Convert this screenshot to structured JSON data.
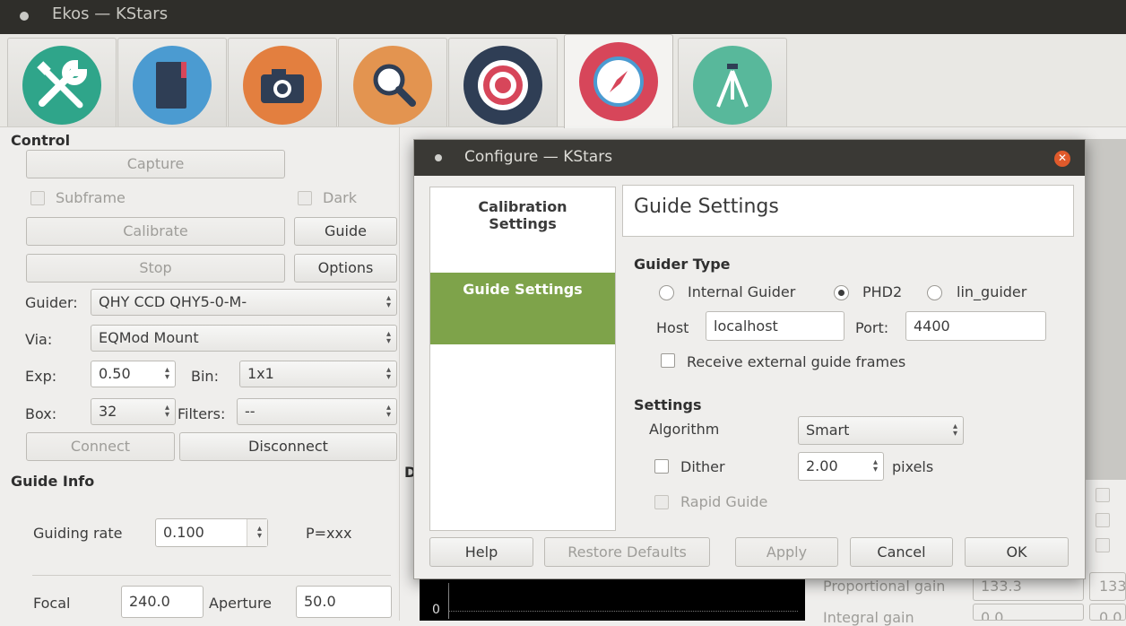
{
  "window": {
    "title": "Ekos — KStars"
  },
  "tabs": [
    {
      "icon": "wrench-screwdriver-icon",
      "color": "#2fa58a"
    },
    {
      "icon": "notebook-icon",
      "color": "#4b9bd1"
    },
    {
      "icon": "camera-icon",
      "color": "#e37f3f"
    },
    {
      "icon": "search-icon",
      "color": "#e39450"
    },
    {
      "icon": "target-icon",
      "color": "#2f3e55"
    },
    {
      "icon": "compass-icon",
      "color": "#d7465a"
    },
    {
      "icon": "tripod-icon",
      "color": "#58b89b"
    }
  ],
  "control": {
    "title": "Control",
    "capture": "Capture",
    "subframe": "Subframe",
    "dark": "Dark",
    "calibrate": "Calibrate",
    "guide": "Guide",
    "stop": "Stop",
    "options": "Options",
    "guider_label": "Guider:",
    "guider_value": "QHY CCD QHY5-0-M-",
    "via_label": "Via:",
    "via_value": "EQMod Mount",
    "exp_label": "Exp:",
    "exp_value": "0.50",
    "bin_label": "Bin:",
    "bin_value": "1x1",
    "box_label": "Box:",
    "box_value": "32",
    "filters_label": "Filters:",
    "filters_value": "--",
    "connect": "Connect",
    "disconnect": "Disconnect"
  },
  "guide_info": {
    "title": "Guide Info",
    "rate_label": "Guiding rate",
    "rate_value": "0.100",
    "p_label": "P=xxx",
    "focal_label": "Focal",
    "focal_value": "240.0",
    "aperture_label": "Aperture",
    "aperture_value": "50.0"
  },
  "background_right": {
    "cut_d": "D",
    "prop_gain_label": "Proportional gain",
    "prop_gain_value": "133.3",
    "prop_gain_value2": "133",
    "integral_gain_label": "Integral gain",
    "integral_gain_value": "0.0",
    "integral_gain_value2": "0.0",
    "graph_zero": "0"
  },
  "dialog": {
    "title": "Configure — KStars",
    "nav": [
      "Calibration Settings",
      "Guide Settings"
    ],
    "header": "Guide Settings",
    "guider_type_title": "Guider Type",
    "radio_internal": "Internal Guider",
    "radio_phd2": "PHD2",
    "radio_lin": "lin_guider",
    "host_label": "Host",
    "host_value": "localhost",
    "port_label": "Port:",
    "port_value": "4400",
    "receive_frames": "Receive external guide frames",
    "settings_title": "Settings",
    "algorithm_label": "Algorithm",
    "algorithm_value": "Smart",
    "dither_label": "Dither",
    "dither_value": "2.00",
    "pixels_label": "pixels",
    "rapid_guide": "Rapid Guide",
    "buttons": {
      "help": "Help",
      "restore": "Restore Defaults",
      "apply": "Apply",
      "cancel": "Cancel",
      "ok": "OK"
    }
  }
}
